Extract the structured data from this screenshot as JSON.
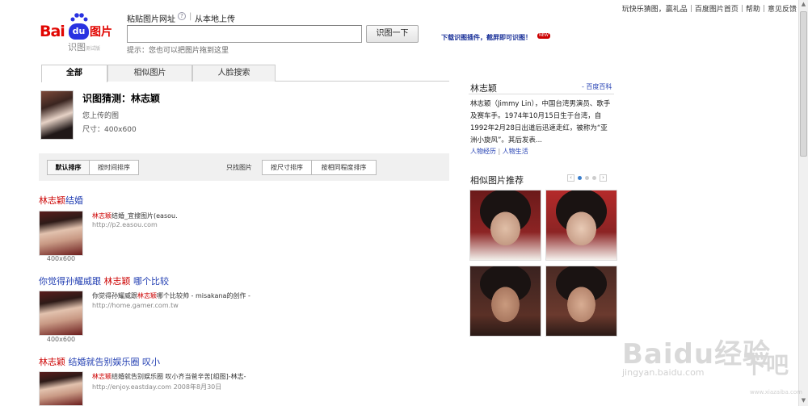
{
  "top_links": [
    "玩快乐猜图，赢礼品",
    "百度图片首页",
    "帮助",
    "意见反馈"
  ],
  "logo": {
    "bai": "Bai",
    "du": "du",
    "tupian": "图片",
    "shitu": "识图",
    "beta": "测试版"
  },
  "search": {
    "paste_label": "粘贴图片网址",
    "help_icon": "?",
    "separator": "|",
    "upload_label": "从本地上传",
    "input_value": "",
    "button_label": "识图一下",
    "hint": "提示：您也可以把图片拖到这里"
  },
  "plugin": {
    "label": "下载识图插件，截屏即可识图！",
    "badge": "NEW"
  },
  "tabs": [
    {
      "label": "全部",
      "active": true
    },
    {
      "label": "相似图片",
      "active": false
    },
    {
      "label": "人脸搜索",
      "active": false
    }
  ],
  "guess": {
    "title": "识图猜测：林志颖",
    "uploaded": "您上传的图",
    "size": "尺寸：400x600"
  },
  "sort": {
    "default": "默认排序",
    "by_time": "按时间排序",
    "filter_label": "只找图片",
    "by_size": "按尺寸排序",
    "by_similarity": "按相同程度排序"
  },
  "results": [
    {
      "title_hl": "林志颖",
      "title_rest": "结婚",
      "dim": "400x600",
      "desc_hl": "林志颖",
      "desc_rest": "结婚_宜搜图片(easou.",
      "url": "http://p2.easou.com"
    },
    {
      "title_pre": "你觉得孙耀威跟 ",
      "title_hl": "林志颖",
      "title_rest": " 哪个比较",
      "dim": "400x600",
      "desc_pre": "你觉得孙耀威跟",
      "desc_hl": "林志颖",
      "desc_rest": "哪个比较帅 - misakana的创作 -",
      "url": "http://home.gamer.com.tw"
    },
    {
      "title_hl": "林志颖",
      "title_rest": " 结婚就告别娱乐圈 叹小",
      "dim": "",
      "desc_hl": "林志颖",
      "desc_rest": "结婚就告别娱乐圈 叹小齐当爸辛苦[组图]-林志-",
      "url": "http://enjoy.eastday.com  2008年8月30日"
    }
  ],
  "panel": {
    "name": "林志颖",
    "baike": "- 百度百科",
    "bio": "林志颖（Jimmy Lin），中国台湾男演员、歌手及赛车手。1974年10月15日生于台湾，自1992年2月28日出道后迅速走红，被称为“亚洲小旋风”。其后发表...",
    "link1": "人物经历",
    "link_sep": "|",
    "link2": "人物生活",
    "similar_title": "相似图片推荐",
    "prev": "‹",
    "next": "›"
  },
  "watermark": {
    "main": "Bai",
    "du": "du",
    "jingyan": "经验",
    "url": "jingyan.baidu.com",
    "ba": "下吧",
    "site": "www.xiazaiba.com"
  }
}
